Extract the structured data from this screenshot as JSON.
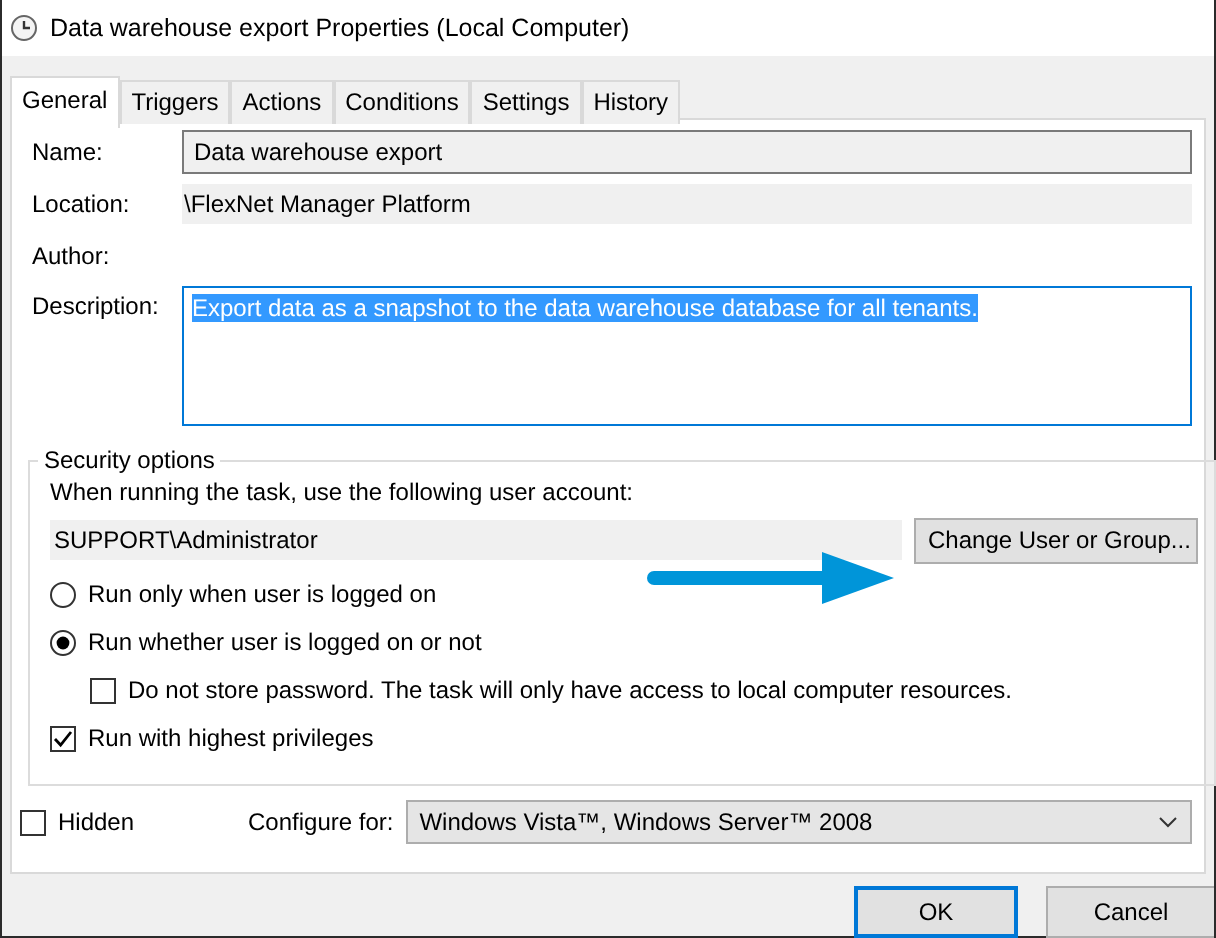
{
  "window": {
    "title": "Data warehouse export Properties (Local Computer)"
  },
  "tabs": [
    {
      "label": "General",
      "selected": true
    },
    {
      "label": "Triggers",
      "selected": false
    },
    {
      "label": "Actions",
      "selected": false
    },
    {
      "label": "Conditions",
      "selected": false
    },
    {
      "label": "Settings",
      "selected": false
    },
    {
      "label": "History",
      "selected": false
    }
  ],
  "fields": [
    {
      "label": "Name:",
      "kind": "input",
      "value": "Data warehouse export"
    },
    {
      "label": "Location:",
      "kind": "readonly",
      "value": "\\FlexNet Manager Platform"
    },
    {
      "label": "Author:",
      "kind": "readonly"
    },
    {
      "label": "Description:",
      "kind": "textarea",
      "value": "Export data as a snapshot to the data warehouse database for all tenants.",
      "text_selected": true
    }
  ],
  "security": {
    "title": "Security options",
    "account_prompt": "When running the task, use the following user account:",
    "account": "SUPPORT\\Administrator",
    "change_button": "Change User or Group...",
    "options": [
      {
        "kind": "radio",
        "label": "Run only when user is logged on",
        "selected": false,
        "indented": false
      },
      {
        "kind": "radio",
        "label": "Run whether user is logged on or not",
        "selected": true,
        "indented": false
      },
      {
        "kind": "checkbox",
        "label": "Do not store password.  The task will only have access to local computer resources.",
        "checked": false,
        "indented": true
      },
      {
        "kind": "checkbox",
        "label": "Run with highest privileges",
        "checked": true,
        "indented": false
      }
    ]
  },
  "hidden": {
    "label": "Hidden",
    "checked": false
  },
  "configure": {
    "label": "Configure for:",
    "value": "Windows Vista™, Windows Server™ 2008"
  },
  "buttons": [
    {
      "label": "OK",
      "focused": true
    },
    {
      "label": "Cancel",
      "focused": false
    }
  ]
}
